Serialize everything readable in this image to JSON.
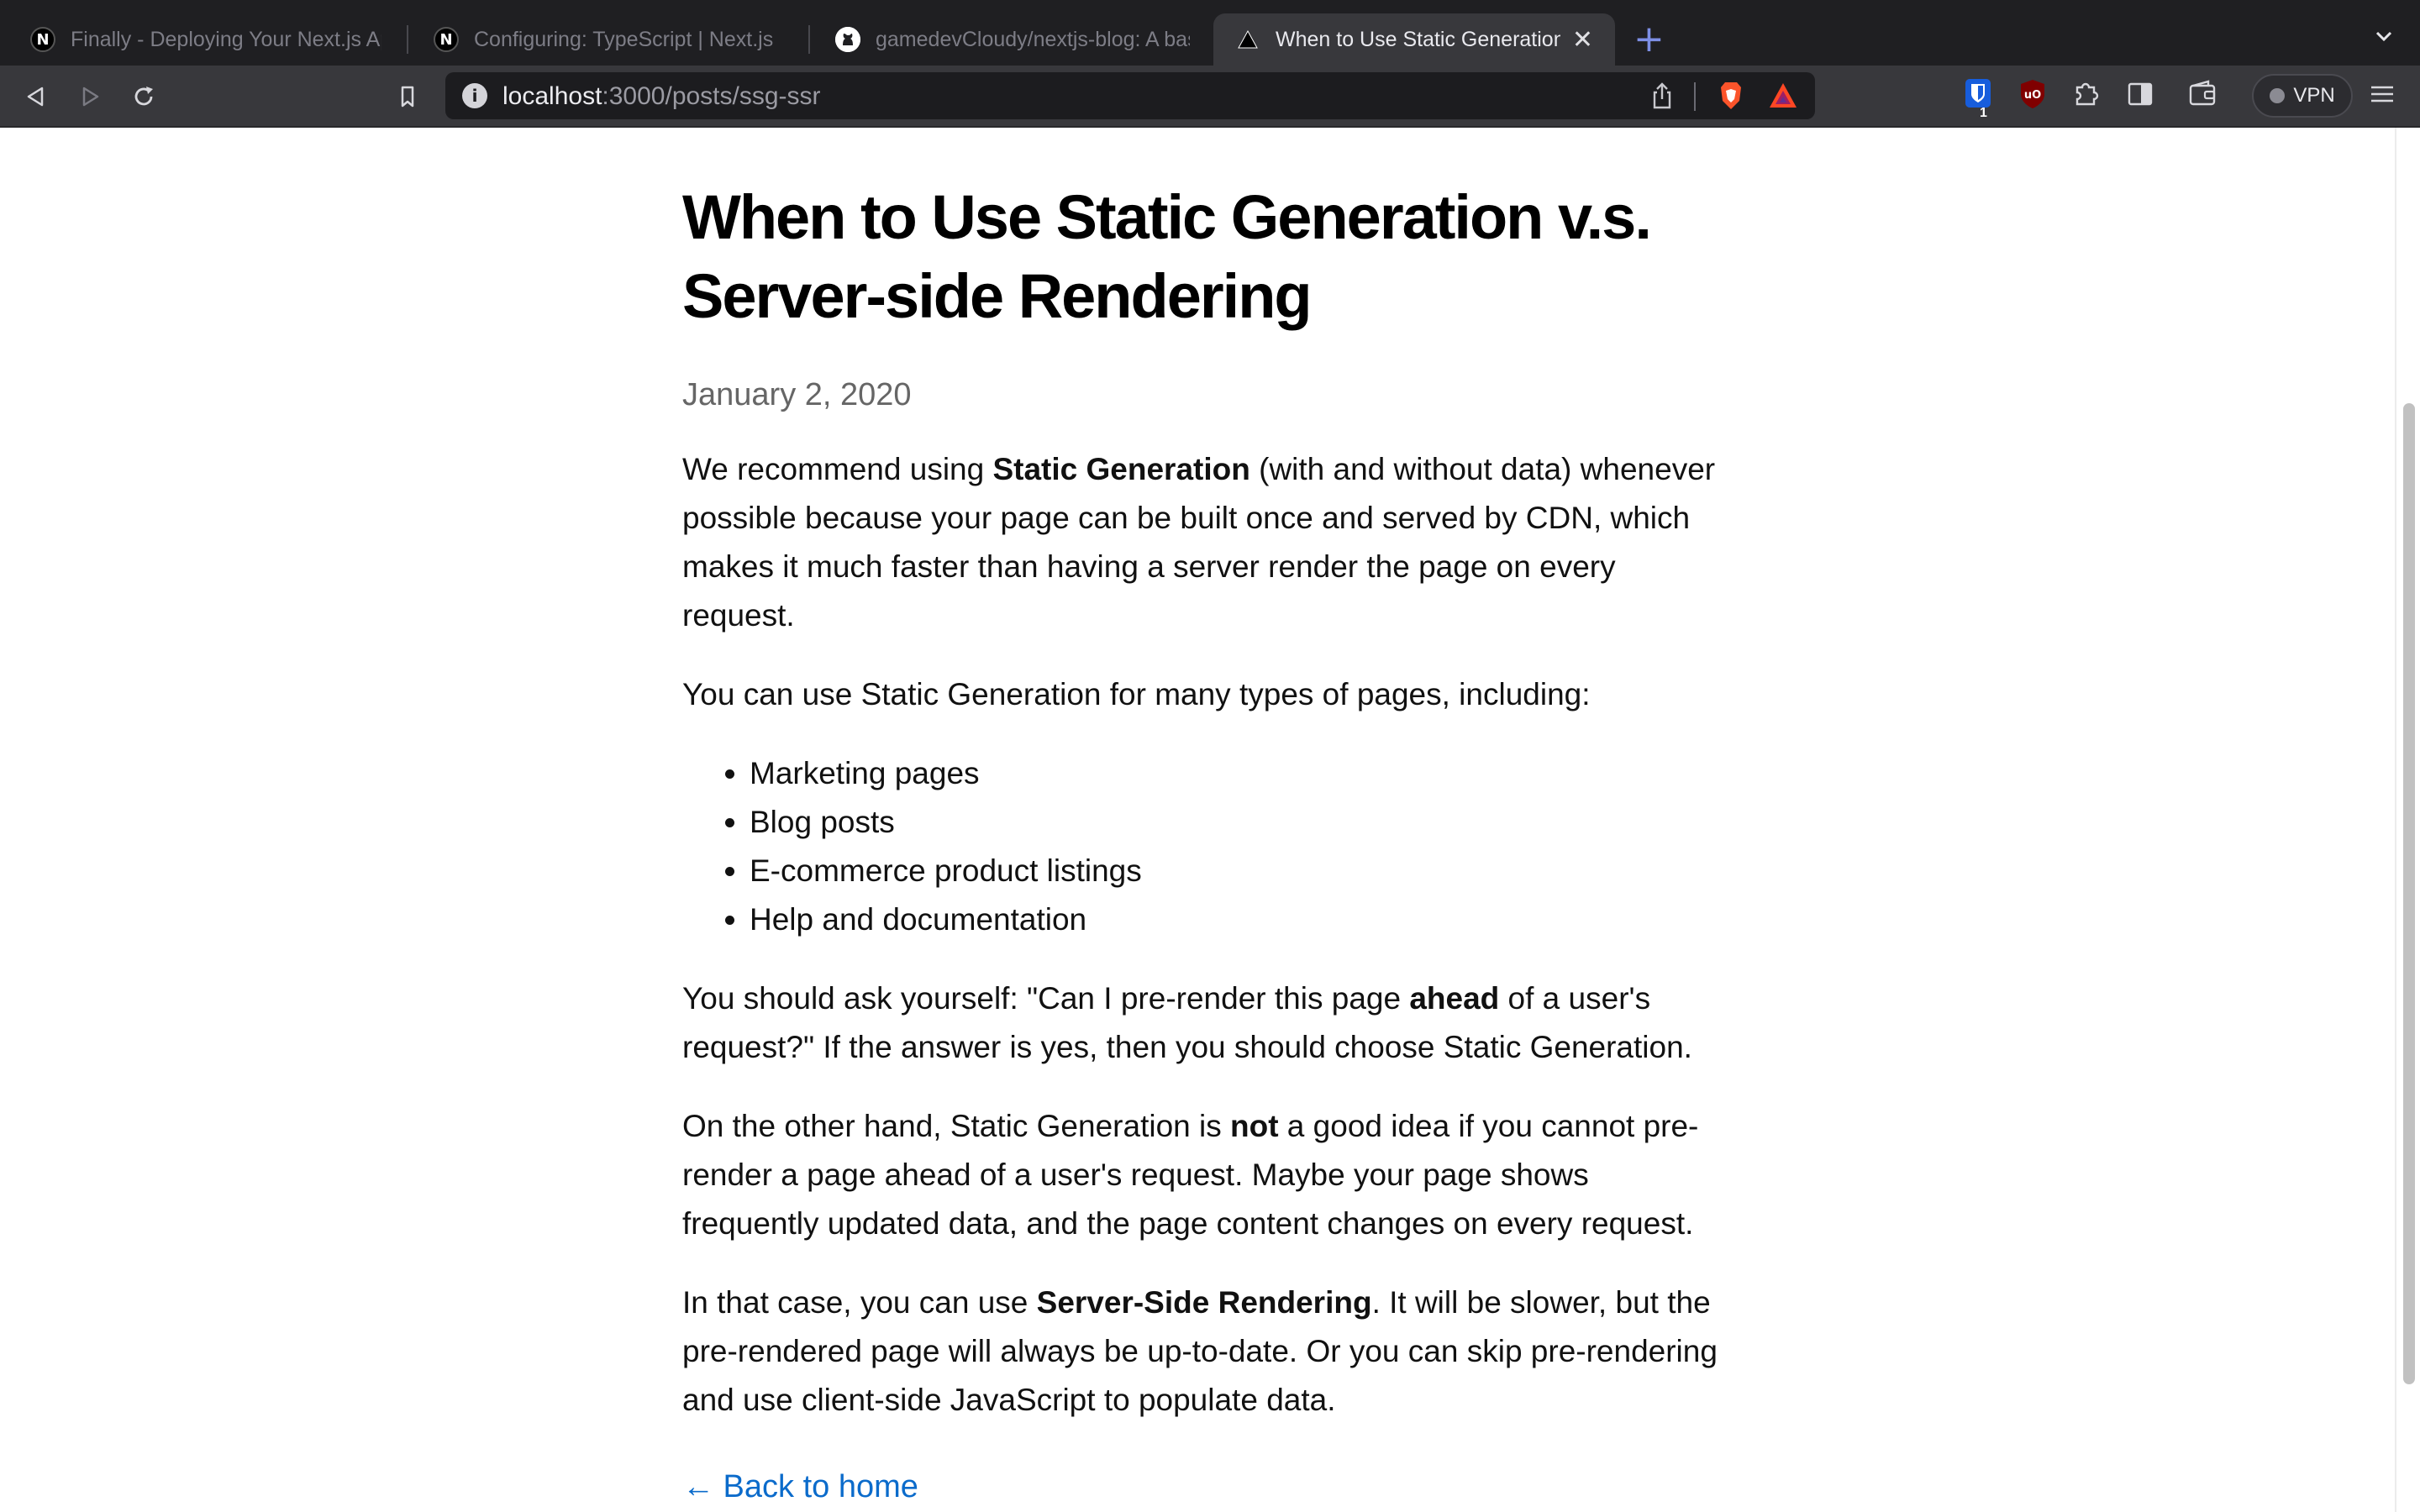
{
  "tabs": [
    {
      "title": "Finally - Deploying Your Next.js App",
      "favicon": "next-icon"
    },
    {
      "title": "Configuring: TypeScript | Next.js",
      "favicon": "next-icon"
    },
    {
      "title": "gamedevCloudy/nextjs-blog: A basic",
      "favicon": "github-icon"
    },
    {
      "title": "When to Use Static Generation v.s.",
      "favicon": "vercel-triangle-icon",
      "active": true
    }
  ],
  "toolbar": {
    "url_host": "localhost",
    "url_path": ":3000/posts/ssg-ssr",
    "extension_badge": "1",
    "vpn_label": "VPN"
  },
  "article": {
    "title": "When to Use Static Generation v.s. Server-side Rendering",
    "date": "January 2, 2020",
    "p1": {
      "a": "We recommend using ",
      "b": "Static Generation",
      "c": " (with and without data) whenever possible because your page can be built once and served by CDN, which makes it much faster than having a server render the page on every request."
    },
    "p2": "You can use Static Generation for many types of pages, including:",
    "list": [
      "Marketing pages",
      "Blog posts",
      "E-commerce product listings",
      "Help and documentation"
    ],
    "p3": {
      "a": "You should ask yourself: \"Can I pre-render this page ",
      "b": "ahead",
      "c": " of a user's request?\" If the answer is yes, then you should choose Static Generation."
    },
    "p4": {
      "a": "On the other hand, Static Generation is ",
      "b": "not",
      "c": " a good idea if you cannot pre-render a page ahead of a user's request. Maybe your page shows frequently updated data, and the page content changes on every request."
    },
    "p5": {
      "a": "In that case, you can use ",
      "b": "Server-Side Rendering",
      "c": ". It will be slower, but the pre-rendered page will always be up-to-date. Or you can skip pre-rendering and use client-side JavaScript to populate data."
    },
    "back_link": "← Back to home"
  },
  "colors": {
    "accent_link": "#0b6bcb",
    "tab_bg": "#1f1f22",
    "toolbar_bg": "#38383c"
  }
}
